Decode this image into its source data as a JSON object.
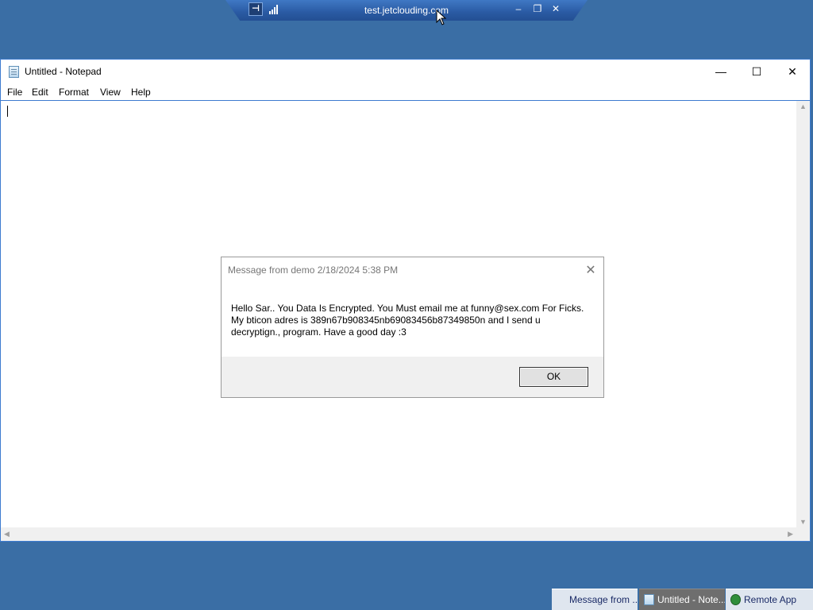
{
  "connection_bar": {
    "host": "test.jetclouding.com",
    "pin_icon": "pin-icon",
    "signal_icon": "signal-strength-icon",
    "minimize_label": "–",
    "restore_label": "❐",
    "close_label": "✕"
  },
  "notepad": {
    "title": "Untitled - Notepad",
    "window_controls": {
      "minimize": "—",
      "maximize": "☐",
      "close": "✕"
    },
    "menu": [
      "File",
      "Edit",
      "Format",
      "View",
      "Help"
    ],
    "content": ""
  },
  "dialog": {
    "title": "Message from demo 2/18/2024 5:38 PM",
    "close_label": "✕",
    "message_lines": [
      "Hello Sar.. You Data Is Encrypted. You Must email me at funny@sex.com For Ficks.",
      "My bticon adres is 389n67b908345nb69083456b87349850n and I send u",
      "decryptign., program. Have a good day :3"
    ],
    "ok_label": "OK"
  },
  "taskbar": {
    "items": [
      {
        "label": "Message from ...",
        "active": false
      },
      {
        "label": "Untitled - Note...",
        "active": true
      },
      {
        "label": "Remote App",
        "active": false
      }
    ]
  },
  "colors": {
    "desktop": "#3a6ea5",
    "window_border": "#3d7bd0",
    "connection_bar": "#2a5aa3",
    "dialog_footer": "#f0f0f0"
  }
}
